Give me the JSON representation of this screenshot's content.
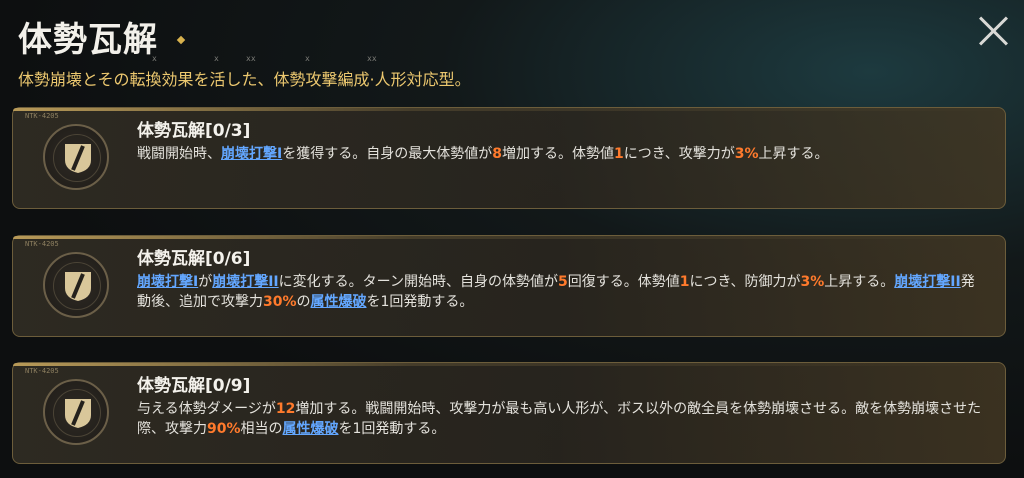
{
  "header": {
    "title": "体勢瓦解",
    "subtitle": "体勢崩壊とその転換効果を活した、体勢攻撃編成·人形対応型。",
    "deco_marks": [
      "x",
      "x",
      "xx",
      "x",
      "xx"
    ]
  },
  "cards": [
    {
      "tag": "NTK-4205",
      "title": "体勢瓦解[0/3]",
      "desc": [
        {
          "t": "戦闘開始時、",
          "s": "n"
        },
        {
          "t": "崩壊打撃I",
          "s": "link"
        },
        {
          "t": "を獲得する。自身の最大体勢値が",
          "s": "n"
        },
        {
          "t": "8",
          "s": "hl"
        },
        {
          "t": "増加する。体勢値",
          "s": "n"
        },
        {
          "t": "1",
          "s": "hl"
        },
        {
          "t": "につき、攻撃力が",
          "s": "n"
        },
        {
          "t": "3%",
          "s": "hl"
        },
        {
          "t": "上昇する。",
          "s": "n"
        }
      ]
    },
    {
      "tag": "NTK-4205",
      "title": "体勢瓦解[0/6]",
      "desc": [
        {
          "t": "崩壊打撃I",
          "s": "link"
        },
        {
          "t": "が",
          "s": "n"
        },
        {
          "t": "崩壊打撃II",
          "s": "link"
        },
        {
          "t": "に変化する。ターン開始時、自身の体勢値が",
          "s": "n"
        },
        {
          "t": "5",
          "s": "hl"
        },
        {
          "t": "回復する。体勢値",
          "s": "n"
        },
        {
          "t": "1",
          "s": "hl"
        },
        {
          "t": "につき、防御力が",
          "s": "n"
        },
        {
          "t": "3%",
          "s": "hl"
        },
        {
          "t": "上昇する。",
          "s": "n"
        },
        {
          "t": "崩壊打撃II",
          "s": "link"
        },
        {
          "t": "発動後、追加で攻撃力",
          "s": "n"
        },
        {
          "t": "30%",
          "s": "hl"
        },
        {
          "t": "の",
          "s": "n"
        },
        {
          "t": "属性爆破",
          "s": "link"
        },
        {
          "t": "を1回発動する。",
          "s": "n"
        }
      ]
    },
    {
      "tag": "NTK-4205",
      "title": "体勢瓦解[0/9]",
      "desc": [
        {
          "t": "与える体勢ダメージが",
          "s": "n"
        },
        {
          "t": "12",
          "s": "hl"
        },
        {
          "t": "増加する。戦闘開始時、攻撃力が最も高い人形が、ボス以外の敵全員を体勢崩壊させる。敵を体勢崩壊させた際、攻撃力",
          "s": "n"
        },
        {
          "t": "90%",
          "s": "hl"
        },
        {
          "t": "相当の",
          "s": "n"
        },
        {
          "t": "属性爆破",
          "s": "link"
        },
        {
          "t": "を1回発動する。",
          "s": "n"
        }
      ]
    }
  ],
  "colors": {
    "highlight": "#ff7a2c",
    "link": "#63a7ff",
    "subtitle": "#ecc86f",
    "card_border": "#6c5d3b"
  },
  "icons": {
    "close": "close-icon",
    "card": "shield-slash-icon"
  }
}
